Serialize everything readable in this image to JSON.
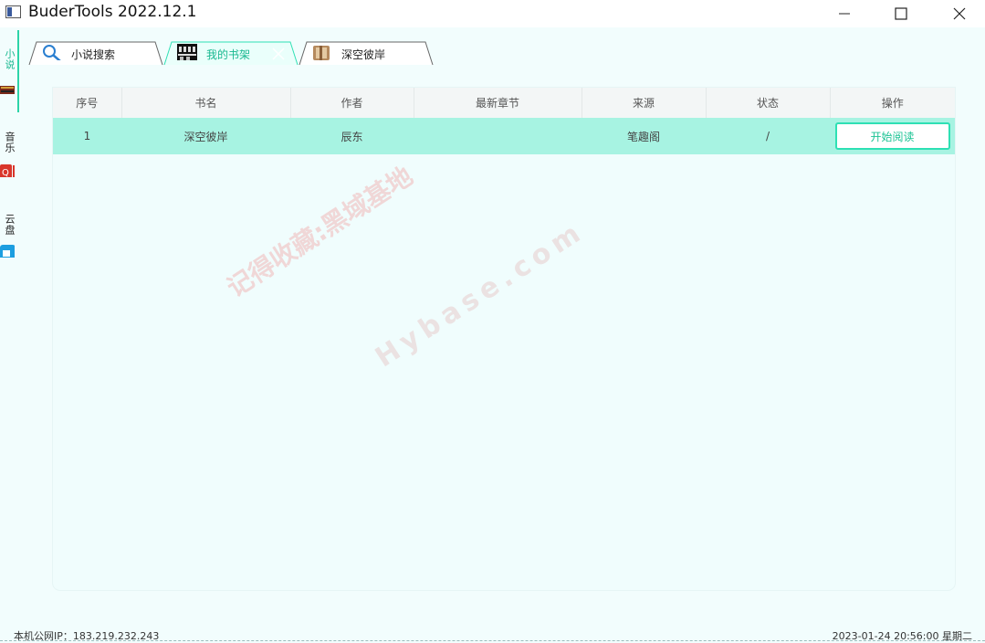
{
  "window": {
    "title": "BuderTools 2022.12.1",
    "buttons": [
      "minimize-icon",
      "maximize-icon",
      "close-icon"
    ]
  },
  "sidebar": {
    "items": [
      {
        "label": "小说",
        "icon": "book-icon",
        "active": true,
        "color": "#18b890"
      },
      {
        "label": "音乐",
        "icon": "music-icon",
        "active": false,
        "color": "#222222"
      },
      {
        "label": "云盘",
        "icon": "cloud-drive-icon",
        "active": false,
        "color": "#222222"
      }
    ]
  },
  "tabs": [
    {
      "label": "小说搜索",
      "icon": "search-icon",
      "active": false
    },
    {
      "label": "我的书架",
      "icon": "bookshelf-icon",
      "active": true
    },
    {
      "label": "深空彼岸",
      "icon": "book-cover-icon",
      "active": false
    }
  ],
  "table": {
    "columns": [
      "序号",
      "书名",
      "作者",
      "最新章节",
      "来源",
      "状态",
      "操作"
    ],
    "rows": [
      {
        "index": "1",
        "title": "深空彼岸",
        "author": "辰东",
        "latest_chapter": "",
        "source": "笔趣阁",
        "status": "/",
        "action": "开始阅读"
      }
    ]
  },
  "watermark": {
    "line1": "记得收藏:黑域基地",
    "line2": "Hybase.com"
  },
  "statusbar": {
    "ip": "本机公网IP：183.219.232.243",
    "datetime": "2023-01-24 20:56:00 星期二"
  },
  "colors": {
    "accent": "#2dd4a8",
    "row_highlight": "#a7f3e2",
    "background": "#f2fdfd"
  }
}
